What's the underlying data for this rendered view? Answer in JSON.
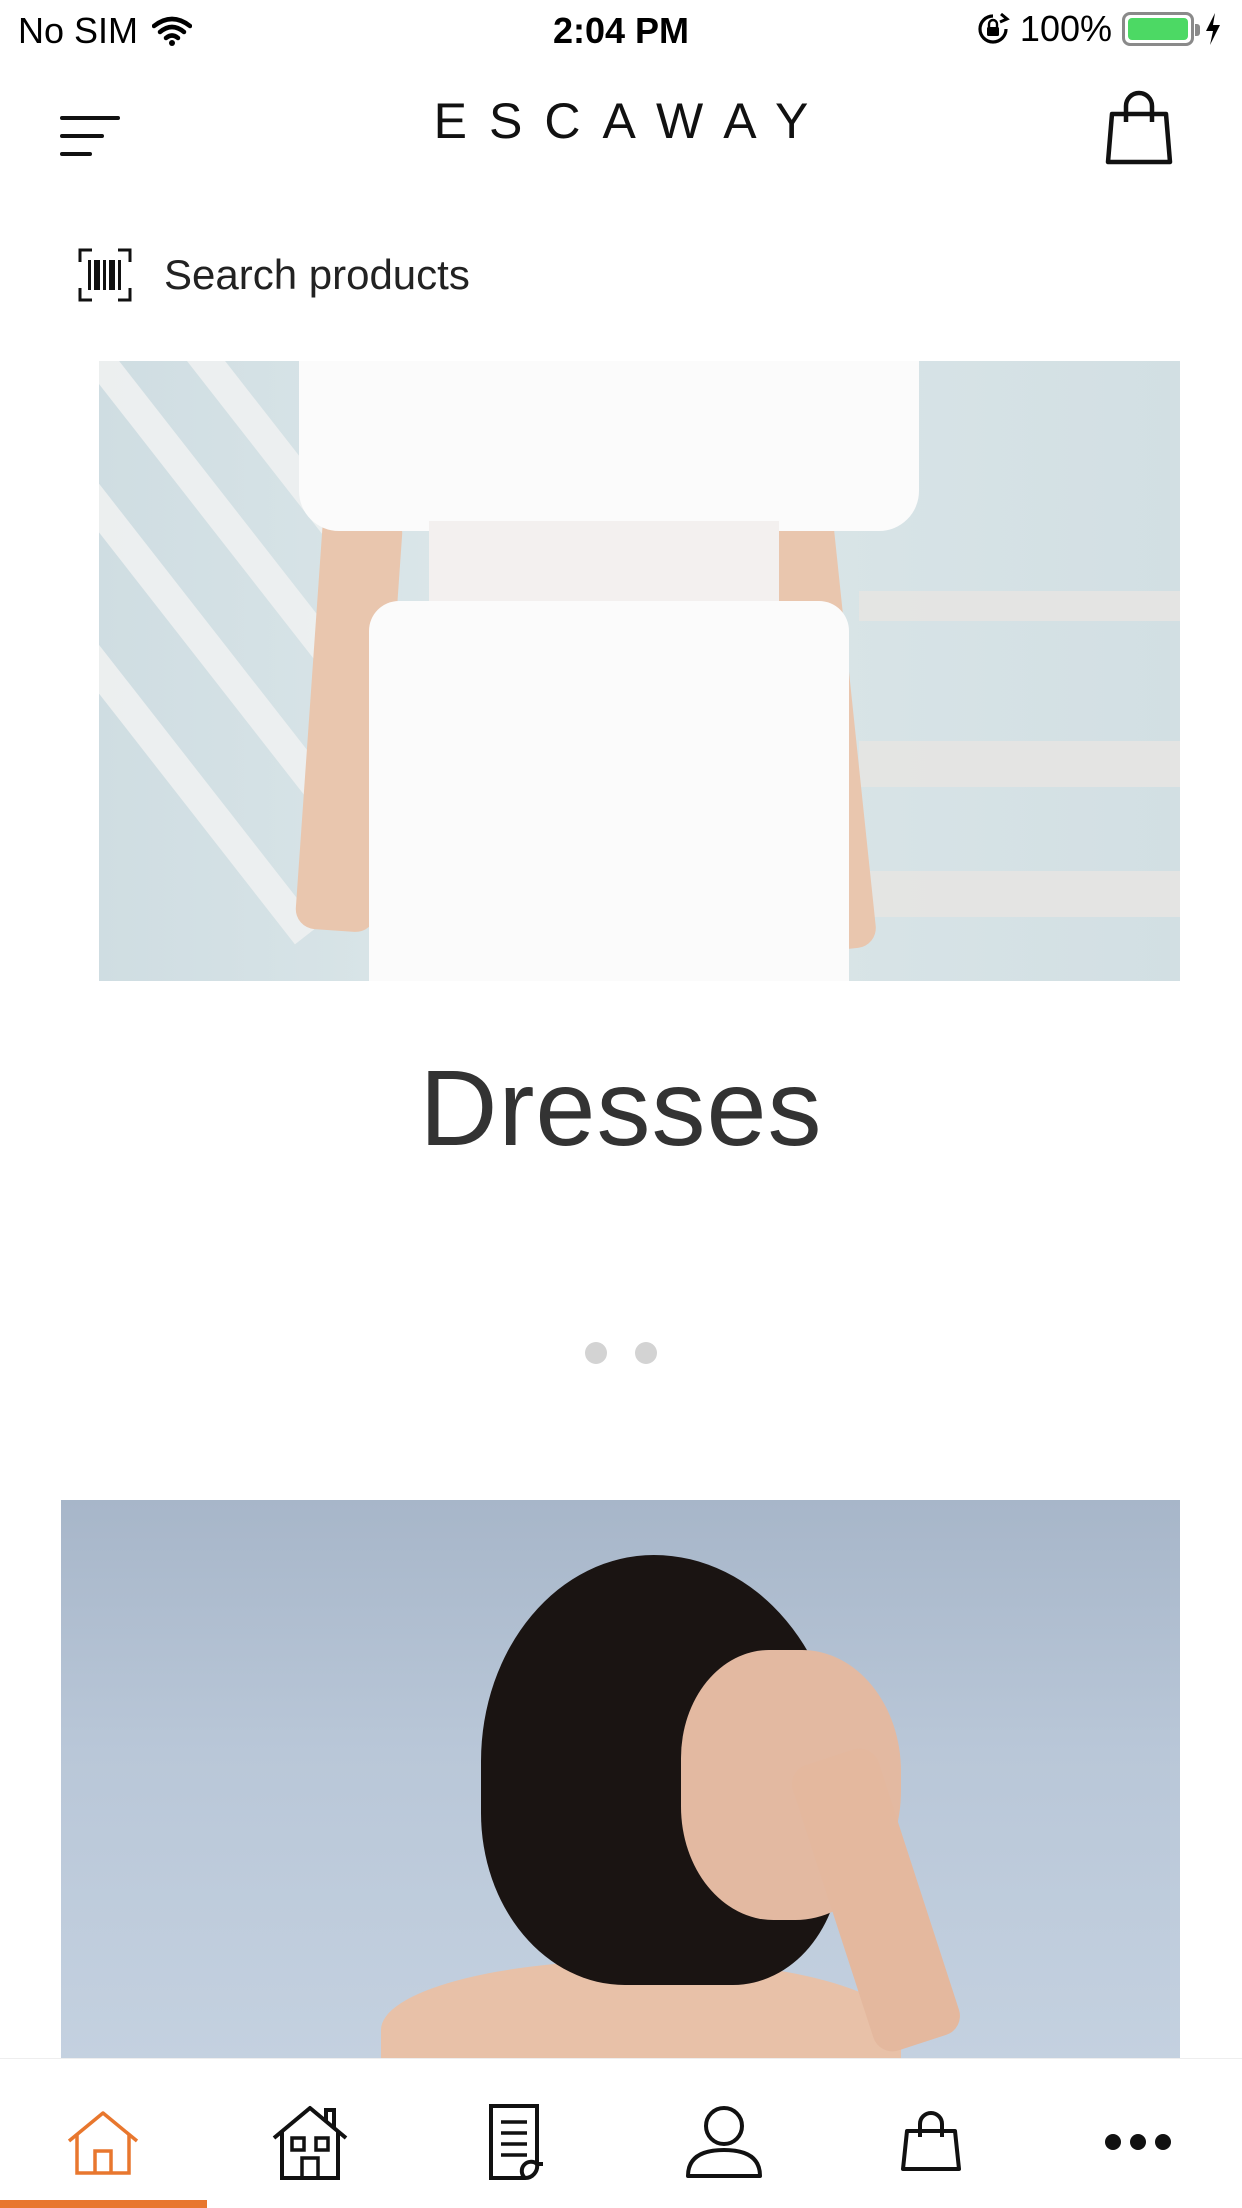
{
  "status_bar": {
    "carrier": "No SIM",
    "time": "2:04 PM",
    "battery": "100%",
    "battery_level": 1.0
  },
  "header": {
    "brand": "ESCAWAY",
    "menu_icon": "hamburger-menu-icon",
    "cart_icon": "shopping-bag-icon"
  },
  "search": {
    "label": "Search products",
    "icon": "barcode-scan-icon"
  },
  "carousel": {
    "caption": "Dresses",
    "dot_count": 2
  },
  "tabbar": {
    "tabs": [
      {
        "icon": "home-icon",
        "active": true
      },
      {
        "icon": "store-icon",
        "active": false
      },
      {
        "icon": "document-icon",
        "active": false
      },
      {
        "icon": "profile-icon",
        "active": false
      },
      {
        "icon": "shopping-bag-icon",
        "active": false
      },
      {
        "icon": "more-icon",
        "active": false
      }
    ]
  },
  "colors": {
    "accent": "#e8772e",
    "battery": "#4cd964",
    "text": "#111111"
  }
}
